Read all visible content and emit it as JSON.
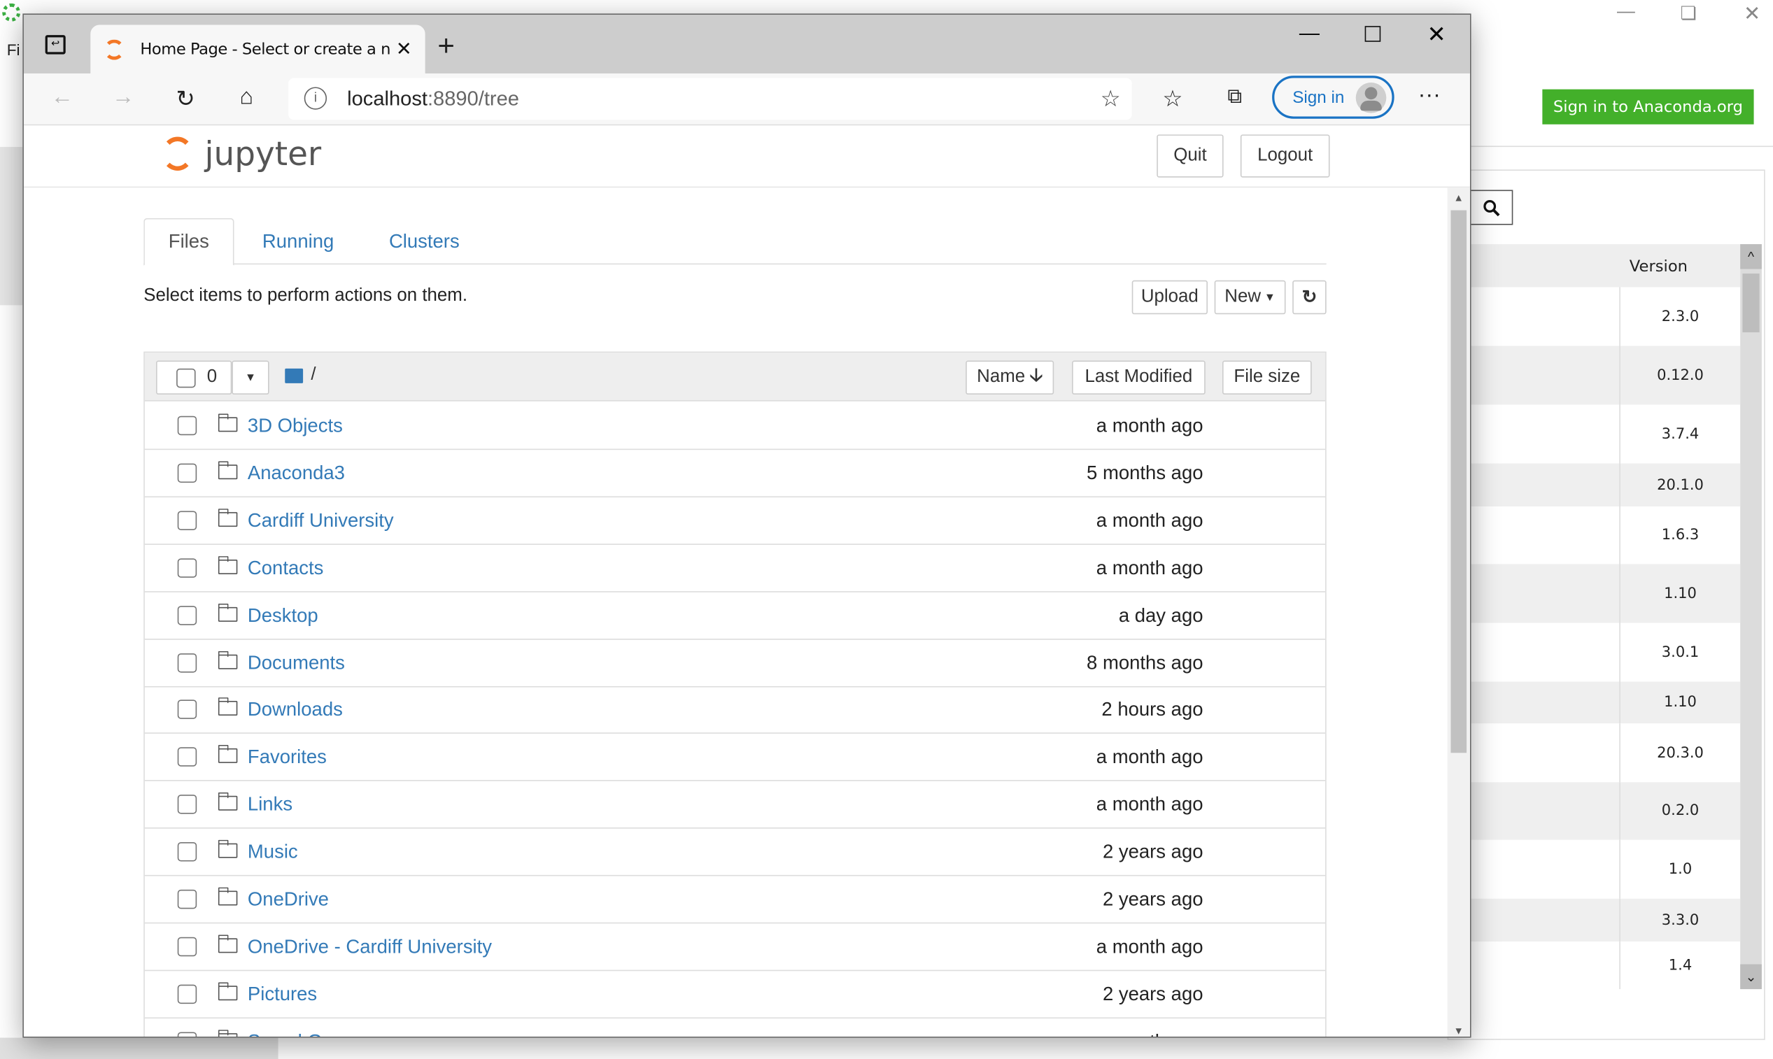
{
  "background_app": {
    "menu_partial": "Fi",
    "sign_in_button": "Sign in to Anaconda.org",
    "table": {
      "version_header": "Version",
      "versions": [
        "2.3.0",
        "0.12.0",
        "3.7.4",
        "20.1.0",
        "1.6.3",
        "1.10",
        "3.0.1",
        "1.10",
        "20.3.0",
        "0.2.0",
        "1.0",
        "3.3.0",
        "1.4"
      ]
    },
    "brand_color": "#43b02a"
  },
  "browser": {
    "tab_title": "Home Page - Select or create a n",
    "url_host": "localhost",
    "url_rest": ":8890/tree",
    "sign_in": "Sign in",
    "more": "···"
  },
  "jupyter": {
    "logo_text": "jupyter",
    "quit": "Quit",
    "logout": "Logout",
    "tabs": [
      "Files",
      "Running",
      "Clusters"
    ],
    "active_tab": "Files",
    "hint": "Select items to perform actions on them.",
    "upload": "Upload",
    "new": "New",
    "selected_count": "0",
    "path": "/",
    "columns": {
      "name": "Name",
      "last_modified": "Last Modified",
      "file_size": "File size"
    },
    "link_color": "#337ab7",
    "items": [
      {
        "name": "3D Objects",
        "modified": "a month ago"
      },
      {
        "name": "Anaconda3",
        "modified": "5 months ago"
      },
      {
        "name": "Cardiff University",
        "modified": "a month ago"
      },
      {
        "name": "Contacts",
        "modified": "a month ago"
      },
      {
        "name": "Desktop",
        "modified": "a day ago"
      },
      {
        "name": "Documents",
        "modified": "8 months ago"
      },
      {
        "name": "Downloads",
        "modified": "2 hours ago"
      },
      {
        "name": "Favorites",
        "modified": "a month ago"
      },
      {
        "name": "Links",
        "modified": "a month ago"
      },
      {
        "name": "Music",
        "modified": "2 years ago"
      },
      {
        "name": "OneDrive",
        "modified": "2 years ago"
      },
      {
        "name": "OneDrive - Cardiff University",
        "modified": "a month ago"
      },
      {
        "name": "Pictures",
        "modified": "2 years ago"
      },
      {
        "name": "Saved Games",
        "modified": "a month ago"
      }
    ]
  }
}
